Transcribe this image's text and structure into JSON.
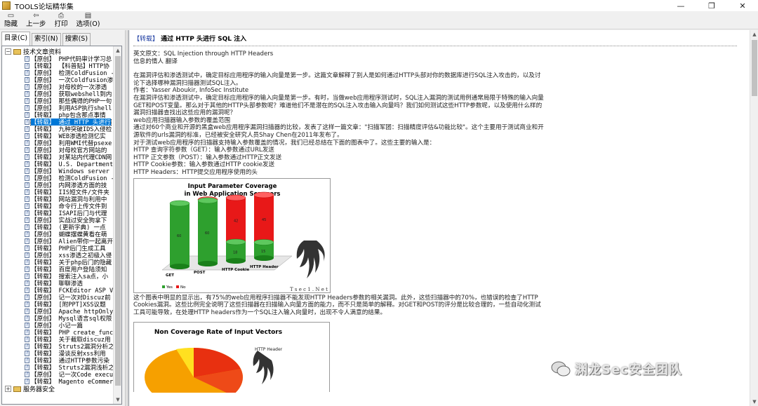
{
  "window": {
    "title": "TOOLS论坛精华集"
  },
  "window_controls": {
    "minimize": "—",
    "maximize": "❐",
    "close": "✕"
  },
  "toolbar": [
    {
      "name": "hide",
      "label": "隐藏",
      "icon": "hide-icon"
    },
    {
      "name": "back",
      "label": "上一步",
      "icon": "back-arrow-icon"
    },
    {
      "name": "print",
      "label": "打印",
      "icon": "printer-icon"
    },
    {
      "name": "options",
      "label": "选项(O)",
      "icon": "options-icon"
    }
  ],
  "tabs": [
    {
      "label": "目录(C)",
      "active": true
    },
    {
      "label": "索引(N)",
      "active": false
    },
    {
      "label": "搜索(S)",
      "active": false
    }
  ],
  "tree": {
    "root_label": "技术文章资料",
    "items": [
      "【原创】 PHP代码审计学习总",
      "【转载】 【科普贴】HTTP协",
      "【原创】 检测ColdFusion -",
      "【原创】 一次Coldfusion渗",
      "【原创】 对母校的一次渗透",
      "【原创】 获取webshell到内",
      "【原创】 那些偶得的PHP一句",
      "【原创】 利用ASP执行shell",
      "【转载】 php包含那点事情",
      "【转载】 通过 HTTP 头进行",
      "【转载】 九种突破IDS入侵检",
      "【转载】 WEB渗透检测忆实",
      "【原创】 利用WMI代替psexe",
      "【原创】 对母校官方网站的",
      "【转载】 对某站内代理CDN网",
      "【转载】 U.S. Department",
      "【原创】 Windows server 2",
      "【原创】 检测ColdFusion -",
      "【原创】 内网渗透方面的技",
      "【转载】 IIS短文件/文件夹",
      "【转载】 网站漏洞与利用中",
      "【转载】 命令行上传文件到",
      "【转载】 ISAPI后门与代理",
      "【原创】 实战过安全狗拿下",
      "【转载】 (更新字典) 一点",
      "【原创】 蝴蝶摆蝶黄看在萌",
      "【原创】 Alien带你一起离开",
      "【转载】 PHP后门生成工具",
      "【原创】 xss渗透之初级入侵",
      "【转载】 关于php后门的隐藏",
      "【转载】 百度用户登陆须知",
      "【转载】 搜索注入sa点，小",
      "【转载】 聊聊渗透",
      "【转载】 FCKEditor ASP V",
      "【原创】 记一次对Discuz前",
      "【转载】 [附PPT]XSS议题",
      "【原创】 Apache httpOnly",
      "【原创】 Mysql语言sql权限",
      "【原创】 小记一篇",
      "【转载】 PHP create_funct",
      "【转载】 关于截取discuz用",
      "【转载】 Struts2漏洞分析之",
      "【转载】 漫谈反射xss利用",
      "【转载】 通过HTTP参数污染",
      "【转载】 Struts2漏洞浅析之",
      "【原创】 记一次Code execu",
      "【转载】 Magento eCommerc"
    ],
    "selected_index": 9,
    "root2_label": "服务器安全"
  },
  "article": {
    "tag": "【转载】",
    "title": "通过 HTTP 头进行 SQL 注入",
    "meta": [
      "英文原文：SQL Injection through HTTP Headers",
      "信息的情人 翻译"
    ],
    "paragraphs": [
      "在漏洞评估和渗透测试中，确定目标应用程序的输入向量是第一步。这篇文章解释了别人是如何通过HTTP头部对你的数据库进行SQL注入攻击的，以及讨论下选择哪种漏洞扫描器测试SQL注入。",
      "作者：Yasser Aboukir, InfoSec Institute",
      "在漏洞评估和渗透测试中，确定目标应用程序的输入向量是第一步。有时，当做web应用程序测试时，SQL注入漏洞的测试用例通常局限于特殊的输入向量GET和POST变量。那么对于其他的HTTP头部参数呢？难道他们不是潜在的SQL注入攻击输入向量吗？我们如何测试这些HTTP参数呢，以及使用什么样的漏洞扫描器查找出这些应用的漏洞呢？",
      "web应用扫描器输入参数的覆盖范围",
      "通过对60个商业和开源的黑盒web应用程序漏洞扫描器的比较，发表了这样一篇文章：\"扫描军团：扫描精度评估&功能比较\"。这个主要用于测试商业和开源软件的urls漏洞的标准，已经被安全研究人员Shay Chen在2011年发布了。",
      "对于测试web应用程序的扫描器支持输入参数覆盖的情况，我们已经总结在下面的图表中了。这些主要的输入是：",
      "HTTP 查询字符参数（GET）：输入参数通过URL发送",
      "HTTP 正文参数（POST）：输入参数通过HTTP正文发送",
      "HTTP Cookie参数：输入参数通过HTTP cookie发送",
      "HTTP Headers：HTTP提交应用程序使用的头"
    ],
    "after_chart": "这个图表中明显的显示出，有75%的web应用程序扫描器不能发现HTTP Headers参数的相关漏洞。此外，这些扫描器中的70%，也错误的检查了HTTP Cookies漏洞。这些比例完全说明了这些扫描器在扫描输入向量方面的能力，而不只是简单的解释。对GET和POST的评分是比较合理的，一些自动化测试工具可能导致，在处理HTTP headers作为一个SQL注入输入向量时，出现不令人满意的结果。"
  },
  "chart_data": [
    {
      "type": "bar",
      "title": "Input Parameter Coverage in Web Application Scanners",
      "categories": [
        "GET",
        "POST",
        "HTTP Cookie",
        "HTTP Header"
      ],
      "series": [
        {
          "name": "Yes",
          "values": [
            60,
            60,
            18,
            15
          ]
        },
        {
          "name": "No",
          "values": [
            0,
            1,
            42,
            45
          ]
        }
      ],
      "ylim": [
        0,
        60
      ],
      "logo_text": "T s e c 1 . N e t"
    },
    {
      "type": "pie",
      "title": "Non Coverage Rate of Input Vectors",
      "label": "HTTP Header"
    }
  ],
  "watermark": {
    "text": "渊龙Sec安全团队"
  },
  "colors": {
    "selection": "#0078d7",
    "yes": "#2ea02e",
    "no": "#e81818",
    "link": "#1a3aa0"
  }
}
